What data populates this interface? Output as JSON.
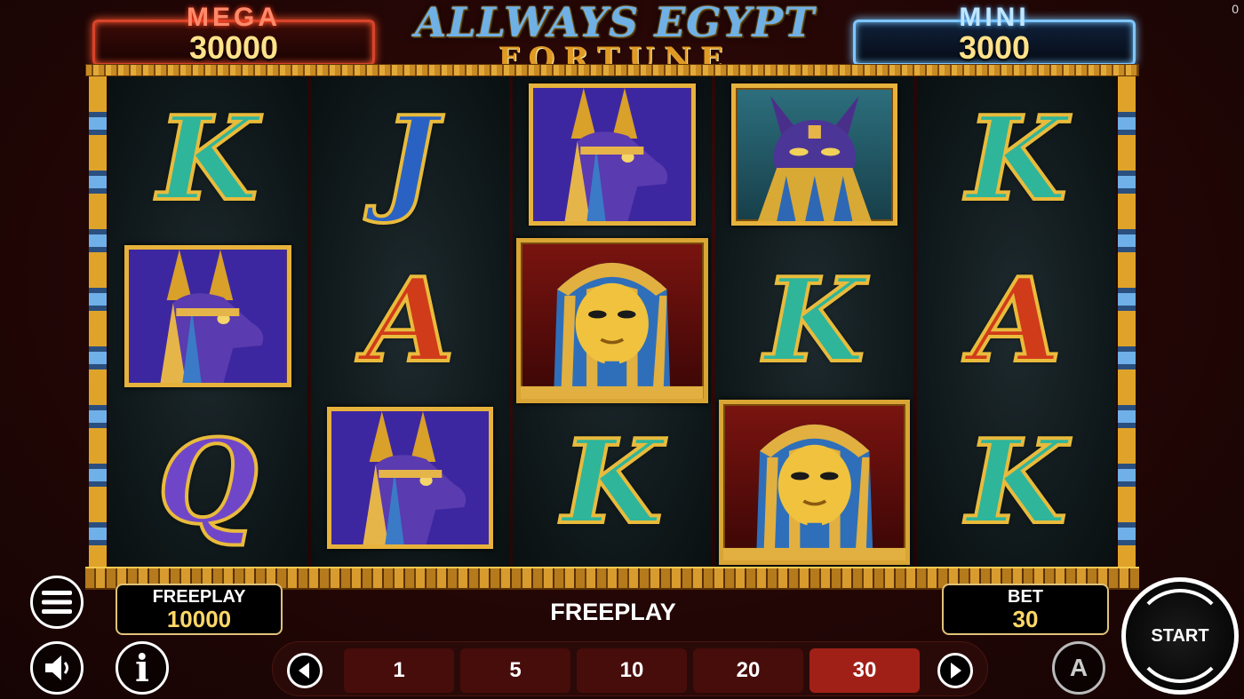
{
  "corner_counter": "0",
  "jackpots": {
    "mega": {
      "label": "MEGA",
      "value": "30000"
    },
    "mini": {
      "label": "MINI",
      "value": "3000"
    }
  },
  "logo": {
    "line1": "ALLWAYS EGYPT",
    "line2": "FORTUNE"
  },
  "reels": [
    [
      "K",
      "anubis",
      "Q"
    ],
    [
      "J",
      "A",
      "anubis"
    ],
    [
      "anubis",
      "pharaoh",
      "K"
    ],
    [
      "cat",
      "K",
      "pharaoh"
    ],
    [
      "K",
      "A",
      "K"
    ]
  ],
  "hud": {
    "freeplay_label": "FREEPLAY",
    "freeplay_value": "10000",
    "center_message": "FREEPLAY",
    "bet_label": "BET",
    "bet_value": "30",
    "start_label": "START",
    "info_label": "i",
    "auto_label": "A"
  },
  "bet_options": [
    "1",
    "5",
    "10",
    "20",
    "30"
  ],
  "selected_bet": "30",
  "icons": [
    "hamburger-menu-icon",
    "sound-icon",
    "info-icon",
    "autoplay-icon",
    "left-arrow-icon",
    "right-arrow-icon"
  ]
}
